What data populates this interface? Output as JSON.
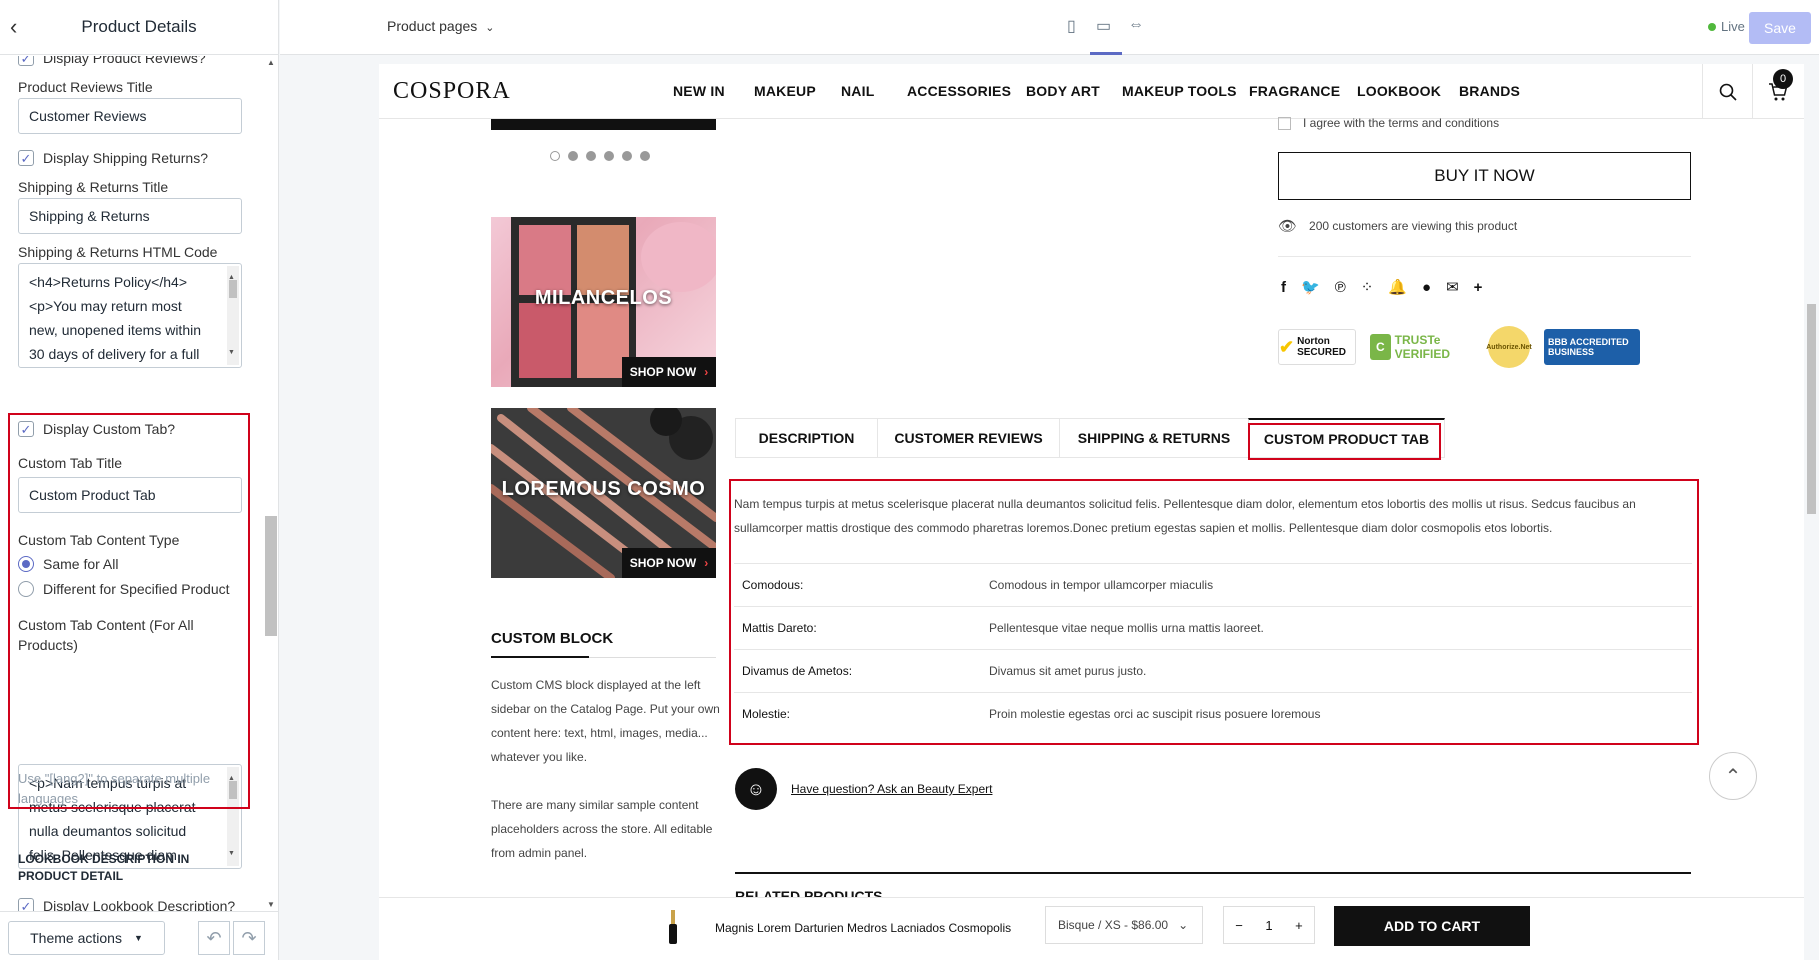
{
  "panel": {
    "title": "Product Details",
    "display_reviews_label": "Display Product Reviews?",
    "reviews_title_label": "Product Reviews Title",
    "reviews_title_value": "Customer Reviews",
    "display_shipping_label": "Display Shipping Returns?",
    "shipping_title_label": "Shipping & Returns Title",
    "shipping_title_value": "Shipping & Returns",
    "shipping_html_label": "Shipping & Returns HTML Code",
    "shipping_html_lines": [
      "<h4>Returns Policy</h4>",
      "<p>You may return most",
      "new, unopened items within",
      "30 days of delivery for a full"
    ],
    "display_custom_tab_label": "Display Custom Tab?",
    "custom_tab_title_label": "Custom Tab Title",
    "custom_tab_title_value": "Custom Product Tab",
    "content_type_label": "Custom Tab Content Type",
    "content_type_options": [
      "Same for All",
      "Different for Specified Product"
    ],
    "content_type_selected": "Same for All",
    "content_label": "Custom Tab Content (For All Products)",
    "content_lines": [
      "<p>Nam tempus turpis at",
      "metus scelerisque placerat",
      "nulla deumantos solicitud",
      "felis. Pellentesque diam dolor,"
    ],
    "content_hint": "Use \"[lang2]\" to separate multiple languages",
    "lookbook_heading": "LOOKBOOK DESCRIPTION IN PRODUCT DETAIL",
    "display_lookbook_label": "Display Lookbook Description?",
    "theme_actions": "Theme actions"
  },
  "topbar": {
    "page_selector": "Product pages",
    "live_label": "Live",
    "save_label": "Save"
  },
  "store": {
    "logo": "COSPORA",
    "nav": [
      "NEW IN",
      "MAKEUP",
      "NAIL",
      "ACCESSORIES",
      "BODY ART",
      "MAKEUP TOOLS",
      "FRAGRANCE",
      "LOOKBOOK",
      "BRANDS"
    ],
    "cart_count": "0",
    "banners": [
      {
        "title": "MILANCELOS",
        "cta": "SHOP NOW"
      },
      {
        "title": "LOREMOUS COSMO",
        "cta": "SHOP NOW"
      }
    ],
    "custom_block_title": "CUSTOM BLOCK",
    "custom_block_p1": "Custom CMS block displayed at the left sidebar on the Catalog Page. Put your own content here: text, html, images, media... whatever you like.",
    "custom_block_p2": "There are many similar sample content placeholders across the store. All editable from admin panel.",
    "agree_text": "I agree with the terms and conditions",
    "buy_now": "BUY IT NOW",
    "viewing_text": "200 customers are viewing this product",
    "trust_badges": [
      "Norton SECURED",
      "TRUSTe VERIFIED",
      "Authorize.Net",
      "BBB ACCREDITED BUSINESS"
    ],
    "tabs": [
      "DESCRIPTION",
      "CUSTOMER REVIEWS",
      "SHIPPING & RETURNS",
      "CUSTOM PRODUCT TAB"
    ],
    "active_tab": "CUSTOM PRODUCT TAB",
    "tab_paragraph": "Nam tempus turpis at metus scelerisque placerat nulla deumantos solicitud felis. Pellentesque diam dolor, elementum etos lobortis des mollis ut risus. Sedcus faucibus an sullamcorper mattis drostique des commodo pharetras loremos.Donec pretium egestas sapien et mollis. Pellentesque diam dolor cosmopolis etos lobortis.",
    "spec_rows": [
      {
        "key": "Comodous:",
        "value": "Comodous in tempor ullamcorper miaculis"
      },
      {
        "key": "Mattis Dareto:",
        "value": "Pellentesque vitae neque mollis urna mattis laoreet."
      },
      {
        "key": "Divamus de Ametos:",
        "value": "Divamus sit amet purus justo."
      },
      {
        "key": "Molestie:",
        "value": "Proin molestie egestas orci ac suscipit risus posuere loremous"
      }
    ],
    "ask_text": "Have question? Ask an Beauty Expert",
    "related_heading": "RELATED PRODUCTS",
    "sticky": {
      "product_name": "Magnis Lorem Darturien Medros Lacniados Cosmopolis",
      "variant": "Bisque / XS - $86.00",
      "quantity": "1",
      "add_to_cart": "ADD TO CART"
    }
  },
  "colors": {
    "highlight": "#d0021b",
    "accent": "#5c6ac4",
    "save_disabled": "#b3bcf5",
    "live_dot": "#50b83c"
  }
}
